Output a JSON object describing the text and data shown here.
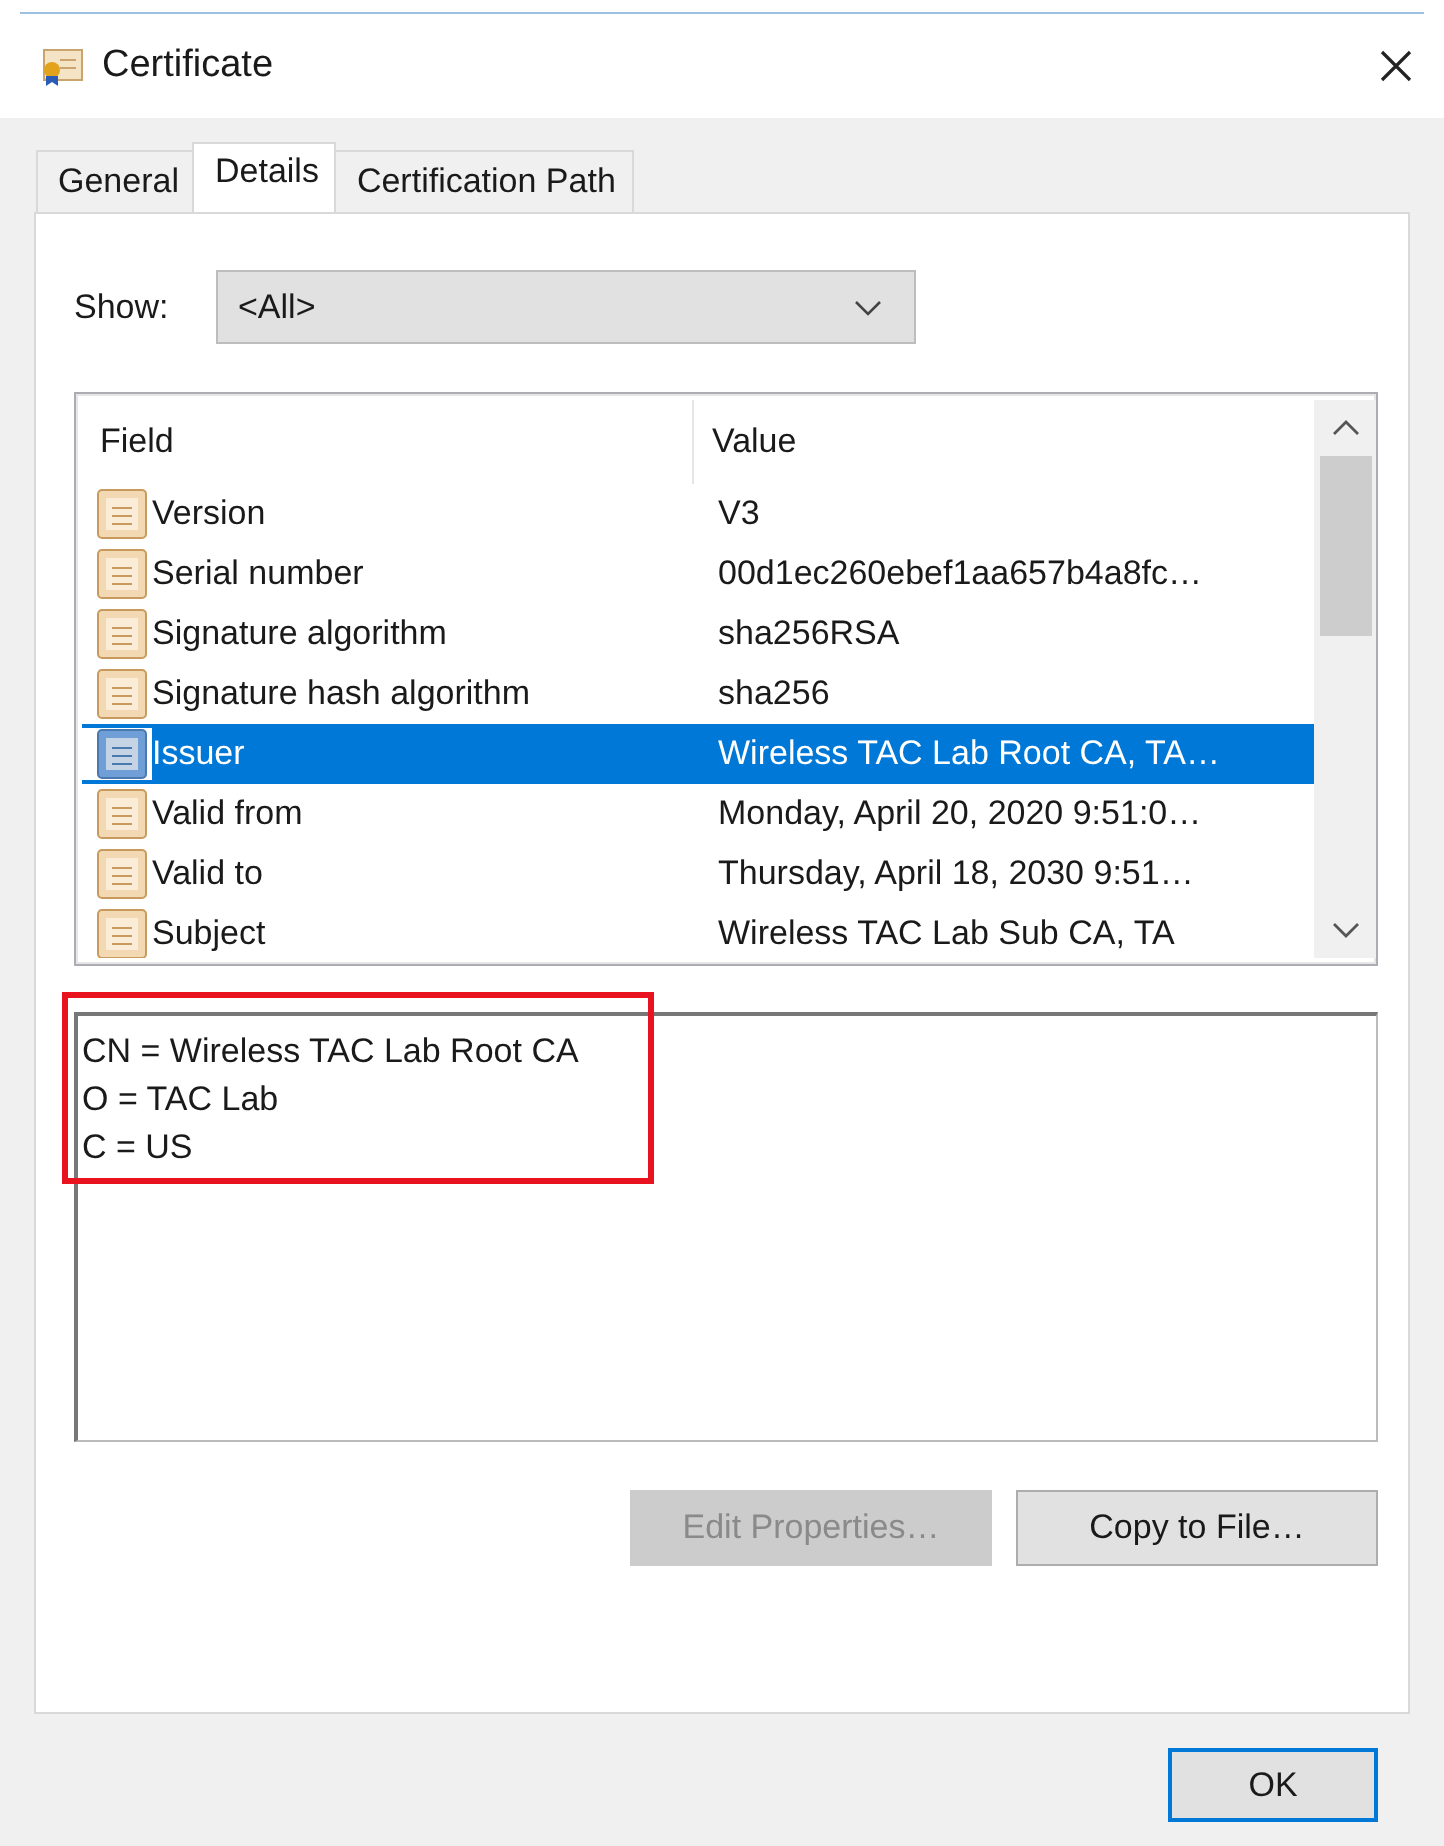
{
  "window": {
    "title": "Certificate"
  },
  "tabs": [
    {
      "label": "General",
      "selected": false
    },
    {
      "label": "Details",
      "selected": true
    },
    {
      "label": "Certification Path",
      "selected": false
    }
  ],
  "show": {
    "label": "Show:",
    "value": "<All>"
  },
  "fields_table": {
    "columns": [
      "Field",
      "Value"
    ],
    "rows": [
      {
        "field": "Version",
        "value": "V3",
        "selected": false
      },
      {
        "field": "Serial number",
        "value": "00d1ec260ebef1aa657b4a8fc…",
        "selected": false
      },
      {
        "field": "Signature algorithm",
        "value": "sha256RSA",
        "selected": false
      },
      {
        "field": "Signature hash algorithm",
        "value": "sha256",
        "selected": false
      },
      {
        "field": "Issuer",
        "value": "Wireless TAC Lab Root CA, TA…",
        "selected": true
      },
      {
        "field": "Valid from",
        "value": "Monday, April 20, 2020 9:51:0…",
        "selected": false
      },
      {
        "field": "Valid to",
        "value": "Thursday, April 18, 2030 9:51…",
        "selected": false
      },
      {
        "field": "Subject",
        "value": "Wireless TAC Lab Sub CA, TA",
        "selected": false
      }
    ]
  },
  "detail": {
    "lines": [
      "CN = Wireless TAC Lab Root CA",
      "O = TAC Lab",
      "C = US"
    ],
    "highlighted": true
  },
  "buttons": [
    {
      "label": "Edit Properties…",
      "disabled": true
    },
    {
      "label": "Copy to File…",
      "disabled": false
    }
  ],
  "ok_button": {
    "label": "OK",
    "default": true
  }
}
